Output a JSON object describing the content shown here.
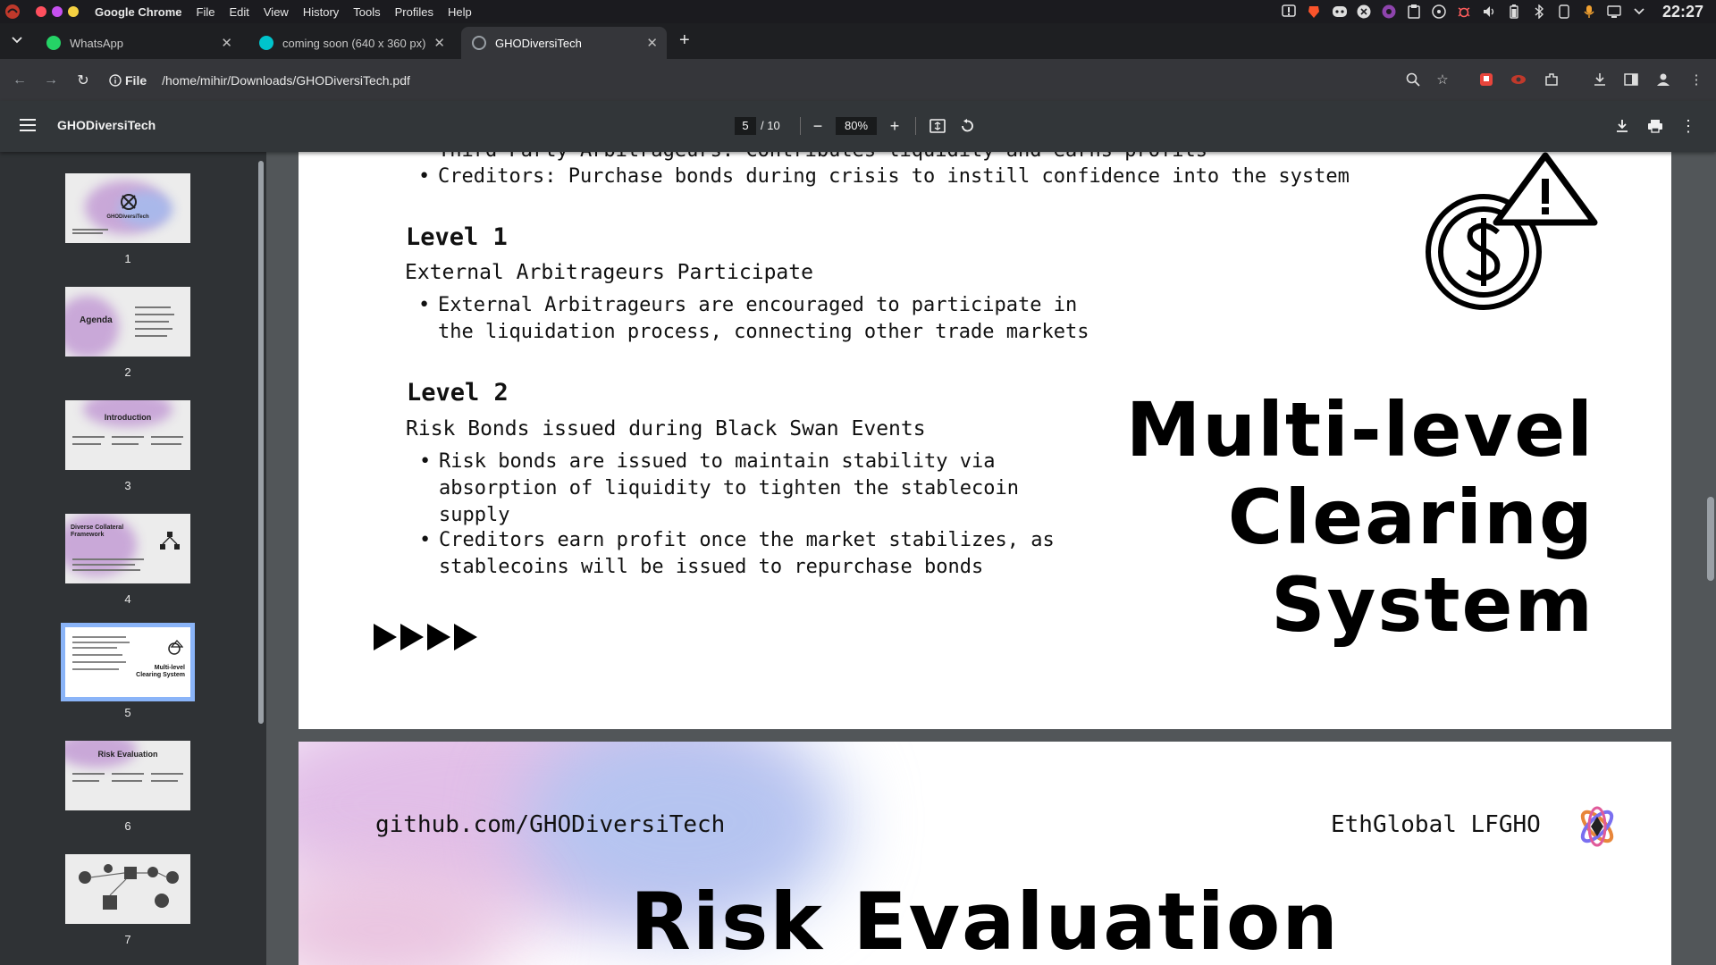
{
  "system": {
    "app_name": "Google Chrome",
    "menus": [
      "File",
      "Edit",
      "View",
      "History",
      "Tools",
      "Profiles",
      "Help"
    ],
    "clock": "22:27",
    "tray_icons": [
      "alert-icon",
      "brave-icon",
      "discord-icon",
      "x-icon",
      "obs-icon",
      "clipboard-icon",
      "cd-icon",
      "bug-icon",
      "volume-icon",
      "battery-icon",
      "bluetooth-icon",
      "phone-icon",
      "mic-icon",
      "display-icon",
      "chevron-down-icon"
    ]
  },
  "tabs": [
    {
      "title": "WhatsApp",
      "icon": "whatsapp-icon",
      "color": "#25d366"
    },
    {
      "title": "coming soon (640 x 360 px)",
      "icon": "canva-icon",
      "color": "#00c4cc"
    },
    {
      "title": "GHODiversiTech",
      "icon": "globe-icon",
      "color": "#9aa0a6"
    }
  ],
  "toolbar": {
    "file_label": "File",
    "url": "/home/mihir/Downloads/GHODiversiTech.pdf"
  },
  "pdf": {
    "title": "GHODiversiTech",
    "current_page": "5",
    "total_pages": "/ 10",
    "zoom": "80%"
  },
  "thumbnails": [
    {
      "num": "1",
      "title": "GHODiversiTech"
    },
    {
      "num": "2",
      "title": "Agenda"
    },
    {
      "num": "3",
      "title": "Introduction"
    },
    {
      "num": "4",
      "title": "Diverse Collateral Framework"
    },
    {
      "num": "5",
      "title": "Multi-level Clearing System"
    },
    {
      "num": "6",
      "title": "Risk Evaluation"
    },
    {
      "num": "7",
      "title": ""
    }
  ],
  "page5": {
    "partial_bullet": "Third Party Arbitrageurs: Contributes liquidity and earns profits",
    "bullet_creditors": "Creditors: Purchase bonds during crisis to instill confidence into the system",
    "level1": "Level 1",
    "level1_sub": "External Arbitrageurs Participate",
    "level1_b1_l1": "External Arbitrageurs are encouraged to participate in",
    "level1_b1_l2": "the liquidation process, connecting other trade markets",
    "level2": "Level 2",
    "level2_sub": "Risk Bonds issued during Black Swan Events",
    "level2_b1_l1": "Risk bonds are issued to maintain stability via",
    "level2_b1_l2": "absorption of liquidity to tighten the stablecoin",
    "level2_b1_l3": "supply",
    "level2_b2_l1": "Creditors earn profit once the market stabilizes, as",
    "level2_b2_l2": "stablecoins will be issued to repurchase bonds",
    "title_l1": "Multi-level",
    "title_l2": "Clearing",
    "title_l3": "System"
  },
  "page6": {
    "github": "github.com/GHODiversiTech",
    "event": "EthGlobal LFGHO",
    "title": "Risk Evaluation"
  }
}
